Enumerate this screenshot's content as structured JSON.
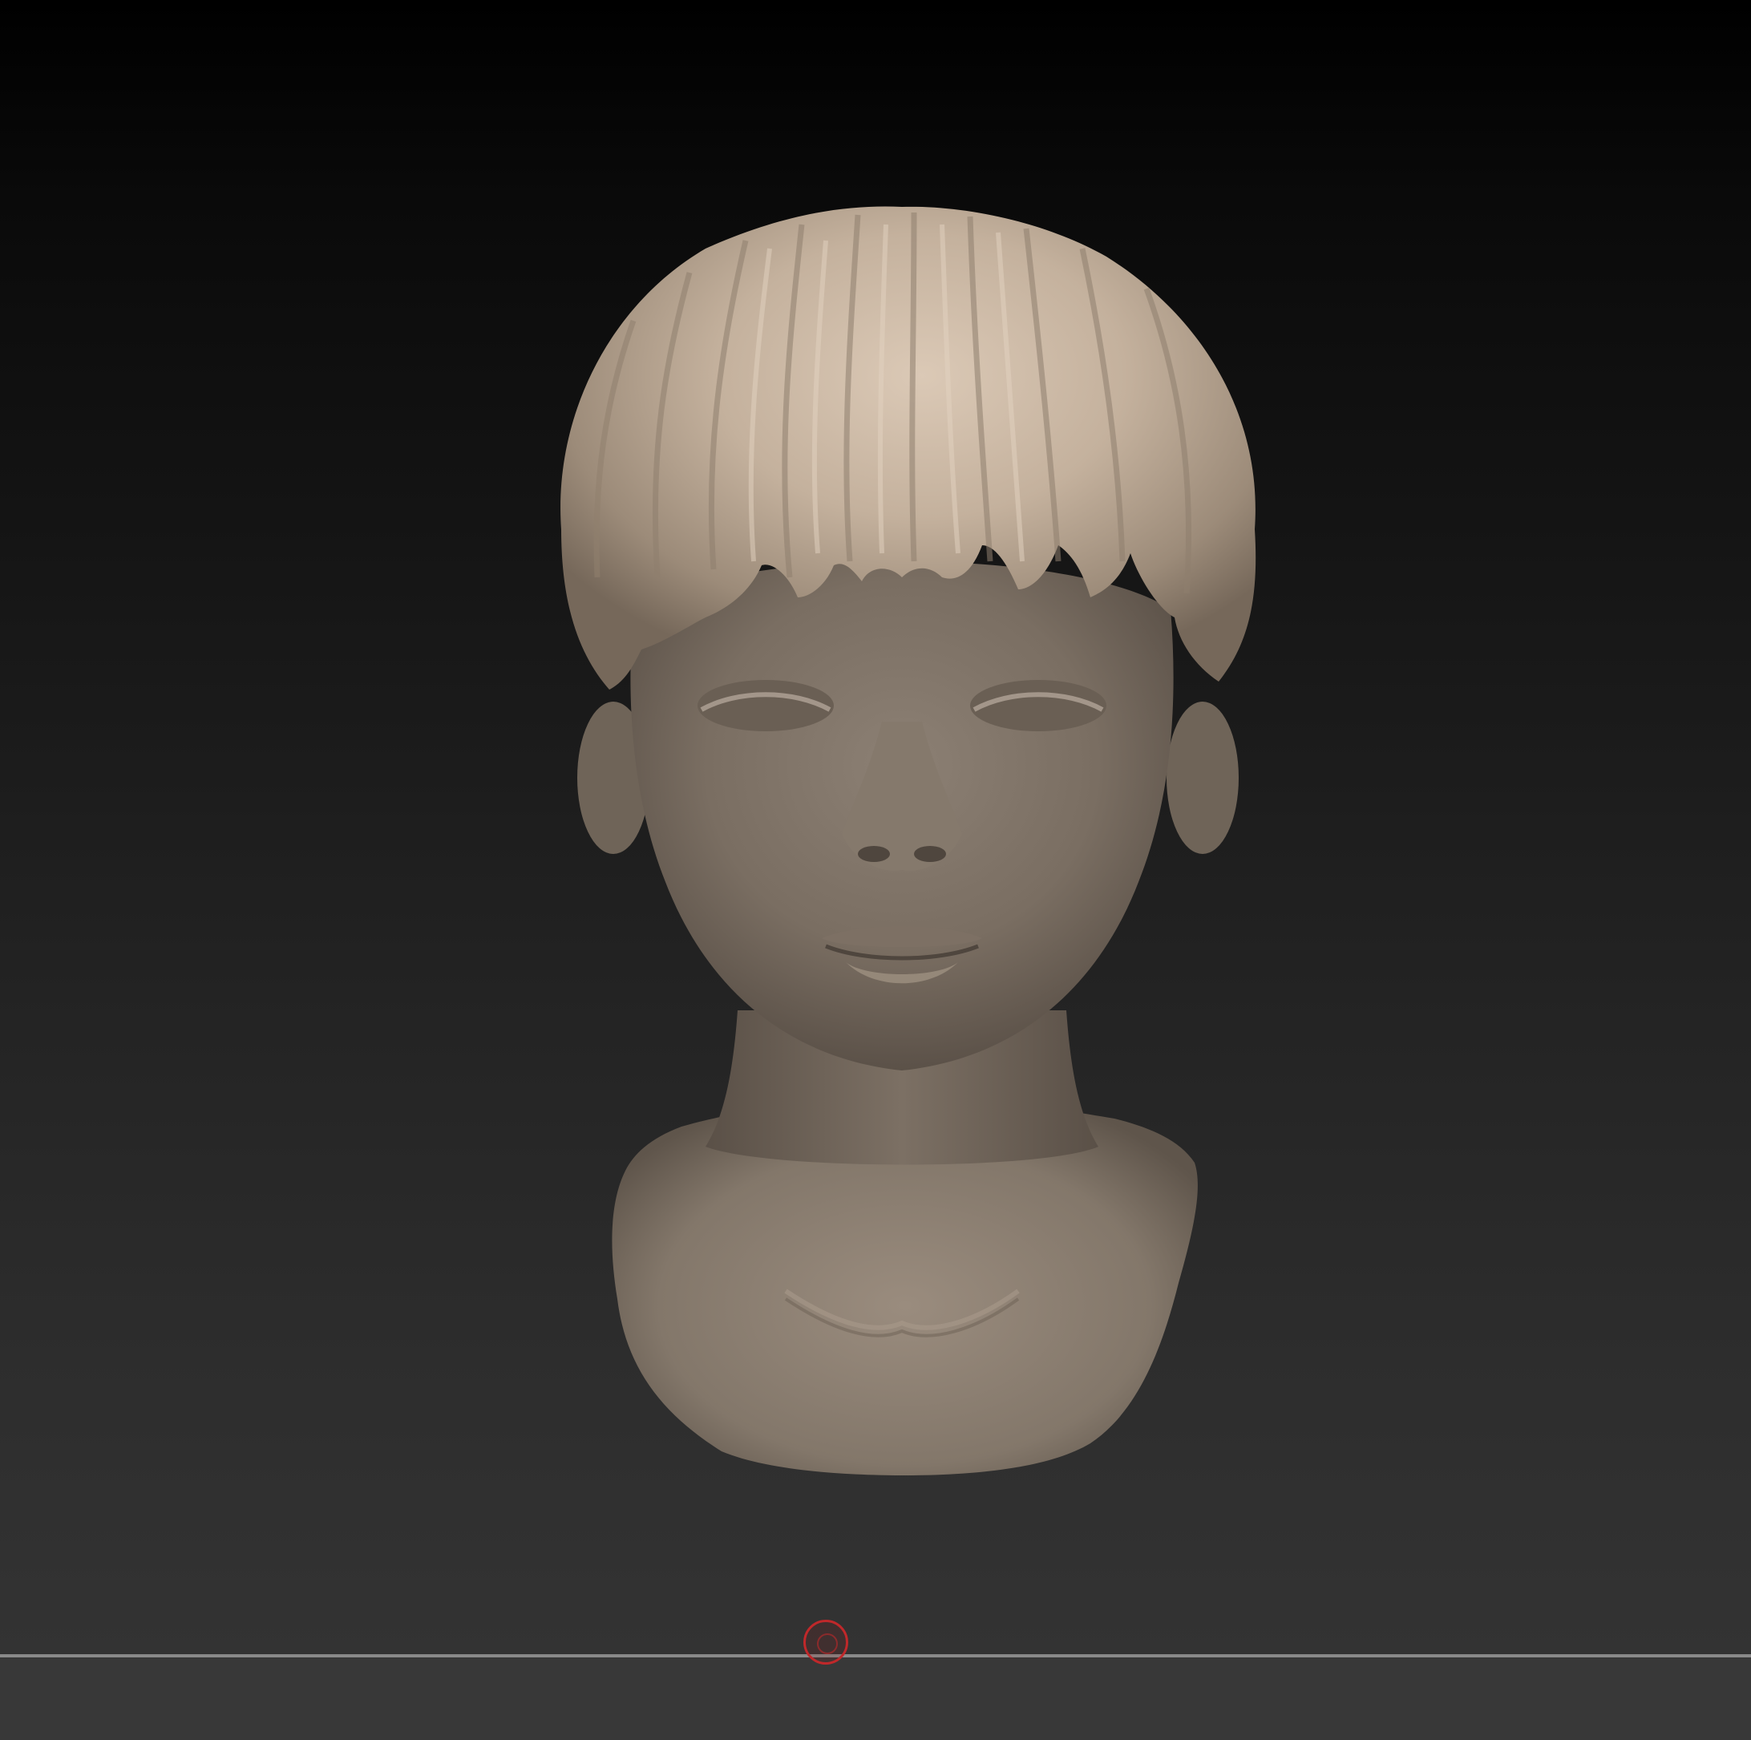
{
  "viewport": {
    "subject": "sculpted-head-bust",
    "background_top": "#000000",
    "background_bottom": "#333333"
  },
  "colors": {
    "clay_dark": "#5e554c",
    "clay_mid": "#8a7d70",
    "clay_light": "#c6b5a3",
    "hair_highlight": "#d9c8b5",
    "floor_line": "#8a8a8a",
    "bottom_bar": "#383838",
    "pivot_marker": "#c0282a"
  },
  "icons": {
    "pivot": "pivot-circle-icon"
  }
}
